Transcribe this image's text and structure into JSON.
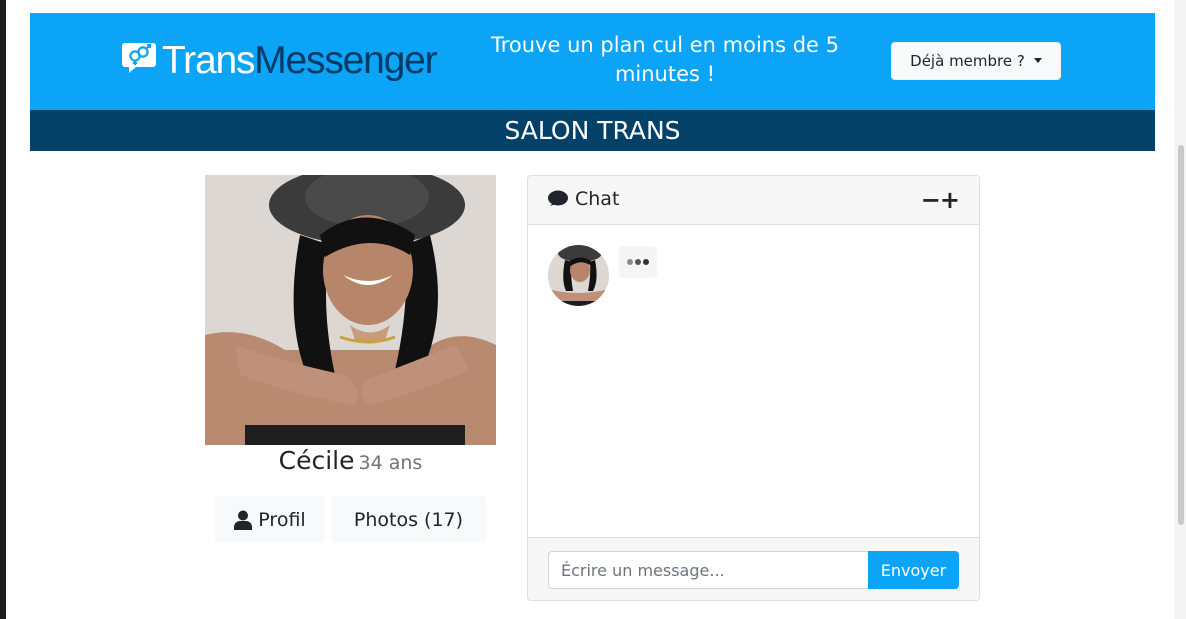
{
  "header": {
    "logo": {
      "part1": "Trans",
      "part2": "Messenger"
    },
    "tagline": "Trouve un plan cul en moins de 5 minutes !",
    "member_button": "Déjà membre ?"
  },
  "subbar": {
    "title": "SALON TRANS"
  },
  "profile": {
    "name": "Cécile",
    "age": "34 ans",
    "profile_button": "Profil",
    "photos_button": "Photos (17)"
  },
  "chat": {
    "title": "Chat",
    "controls": "−+",
    "input_placeholder": "Écrire un message...",
    "send_button": "Envoyer"
  },
  "colors": {
    "brand_blue": "#0ba4f7",
    "navy": "#034168",
    "logo_navy": "#003b66"
  },
  "icons": [
    "gender-chat-logo-icon",
    "user-icon",
    "comment-icon",
    "typing-dots-icon"
  ]
}
